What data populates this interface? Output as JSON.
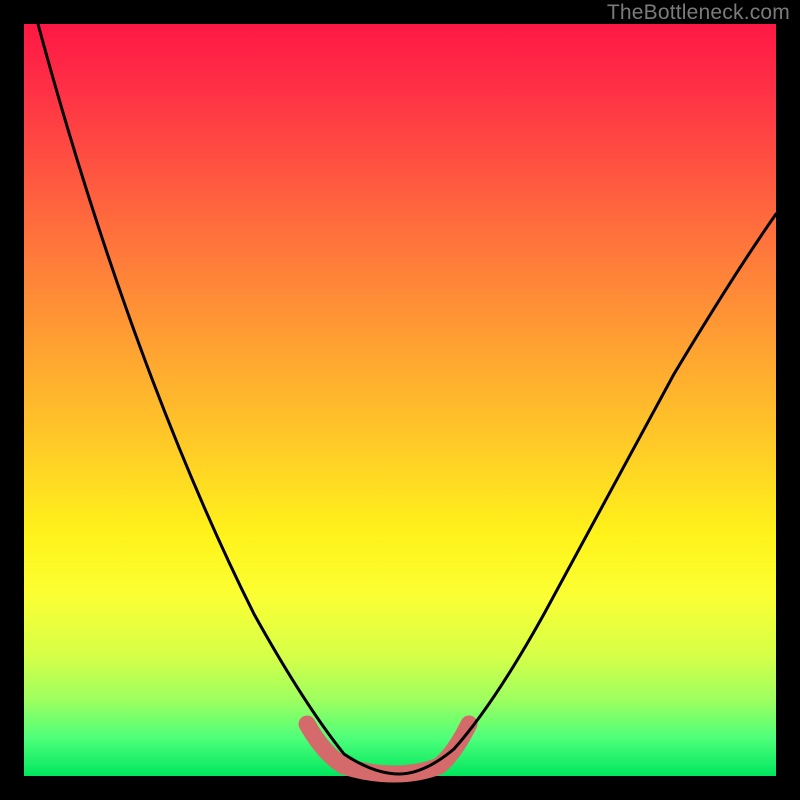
{
  "watermark": "TheBottleneck.com",
  "colors": {
    "frame": "#000000",
    "gradient_top": "#ff1844",
    "gradient_mid1": "#ff7e3a",
    "gradient_mid2": "#fff31a",
    "gradient_bottom": "#00e65e",
    "curve": "#000000",
    "highlight": "#d46a6a"
  },
  "chart_data": {
    "type": "line",
    "title": "",
    "xlabel": "",
    "ylabel": "",
    "xlim": [
      0,
      100
    ],
    "ylim": [
      0,
      100
    ],
    "series": [
      {
        "name": "bottleneck-curve",
        "x": [
          2,
          5,
          10,
          15,
          20,
          25,
          30,
          35,
          38,
          41,
          44,
          47,
          50,
          53,
          57,
          62,
          68,
          74,
          80,
          86,
          92,
          98
        ],
        "y": [
          100,
          92,
          80,
          68,
          56,
          44,
          32,
          20,
          12,
          6,
          2,
          1,
          1,
          2,
          6,
          13,
          22,
          32,
          42,
          52,
          61,
          70
        ]
      },
      {
        "name": "optimal-zone-highlight",
        "x": [
          38,
          41,
          44,
          47,
          50,
          53,
          57
        ],
        "y": [
          12,
          6,
          2,
          1,
          1,
          2,
          6
        ]
      }
    ],
    "annotations": []
  }
}
